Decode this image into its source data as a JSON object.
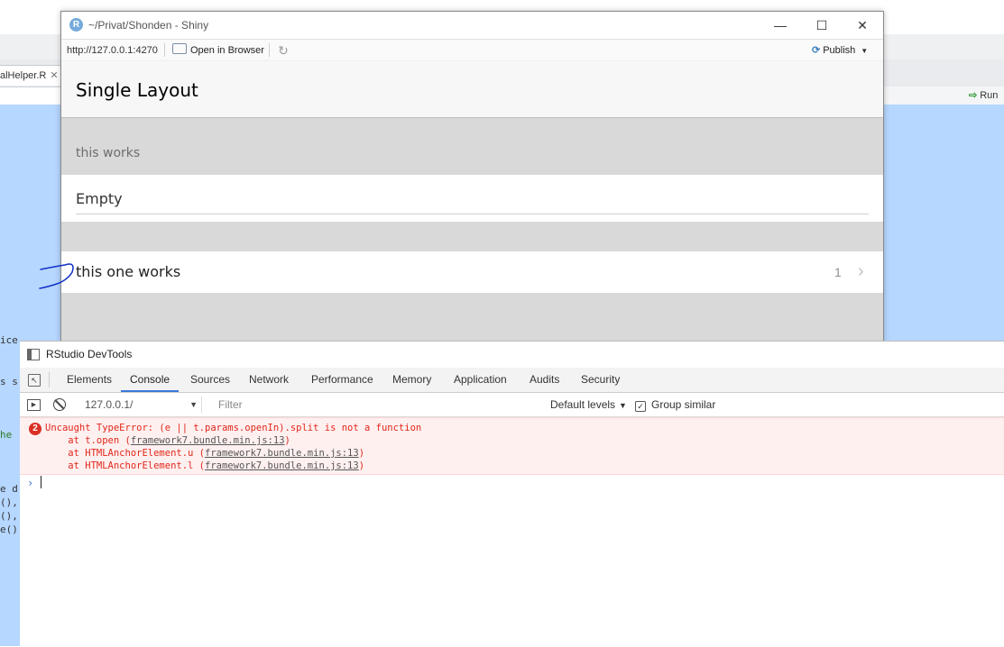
{
  "background": {
    "editor_tab": {
      "label": "alHelper.R",
      "close": "✕"
    },
    "run_button": "Run",
    "code_fragments": [
      "ice",
      "s s",
      "he",
      "e d",
      "(),",
      "(),",
      "e()"
    ]
  },
  "shiny_window": {
    "title": "~/Privat/Shonden - Shiny",
    "logo": "R",
    "controls": {
      "minimize": "—",
      "maximize": "☐",
      "close": "✕"
    },
    "url": "http://127.0.0.1:4270",
    "open_in_browser": "Open in Browser",
    "publish": "Publish",
    "app": {
      "title": "Single Layout",
      "block_title": "this works",
      "list1_item": "Empty",
      "list2_item": {
        "label": "this one works",
        "badge": "1",
        "chevron": "›"
      }
    }
  },
  "devtools": {
    "title": "RStudio DevTools",
    "tabs": [
      "Elements",
      "Console",
      "Sources",
      "Network",
      "Performance",
      "Memory",
      "Application",
      "Audits",
      "Security"
    ],
    "active_tab": "Console",
    "context": "127.0.0.1/",
    "filter_placeholder": "Filter",
    "levels": "Default levels",
    "group_similar": "Group similar",
    "error": {
      "count": "2",
      "message": "Uncaught TypeError: (e || t.params.openIn).split is not a function",
      "stack": [
        {
          "prefix": "    at t.open (",
          "file": "framework7.bundle.min.js:13",
          "suffix": ")"
        },
        {
          "prefix": "    at HTMLAnchorElement.u (",
          "file": "framework7.bundle.min.js:13",
          "suffix": ")"
        },
        {
          "prefix": "    at HTMLAnchorElement.l (",
          "file": "framework7.bundle.min.js:13",
          "suffix": ")"
        }
      ]
    },
    "prompt": "›"
  },
  "colors": {
    "editor_highlight": "#b6d7ff",
    "active_tab": "#3879d9",
    "error_text": "#e0271a",
    "error_bg": "#fff0f0",
    "annotation_ink": "#1030c8"
  }
}
